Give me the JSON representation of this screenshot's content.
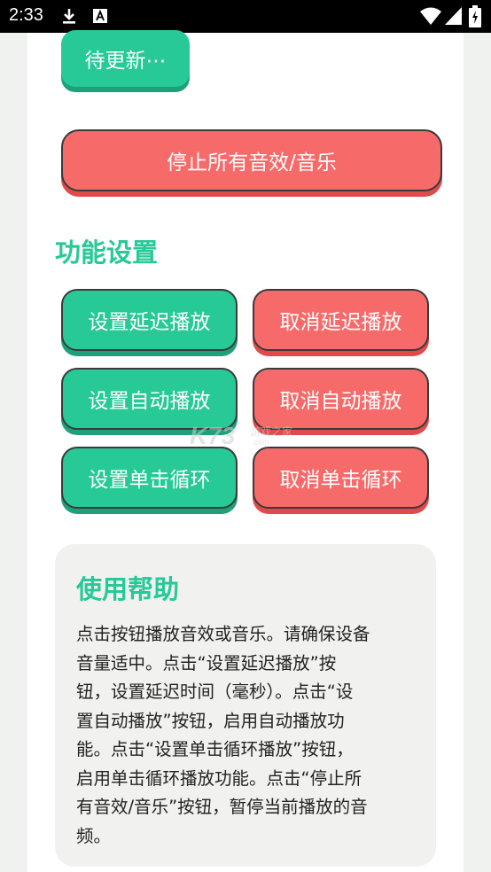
{
  "status_bar": {
    "time": "2:33",
    "icons": [
      "download-icon",
      "a-icon",
      "wifi-icon",
      "signal-icon",
      "battery-icon"
    ]
  },
  "buttons": {
    "pending_update": "待更新⋯",
    "stop_all": "停止所有音效/音乐"
  },
  "settings": {
    "title": "功能设置",
    "set_delay": "设置延迟播放",
    "cancel_delay": "取消延迟播放",
    "set_auto": "设置自动播放",
    "cancel_auto": "取消自动播放",
    "set_loop": "设置单击循环",
    "cancel_loop": "取消单击循环"
  },
  "help": {
    "title": "使用帮助",
    "lines": [
      "点击按钮播放音效或音乐。请确保设备",
      "音量适中。点击“设置延迟播放”按",
      "钮，设置延迟时间（毫秒）。点击“设",
      "置自动播放”按钮，启用自动播放功",
      "能。点击“设置单击循环播放”按钮，",
      "启用单击循环播放功能。点击“停止所",
      "有音效/音乐”按钮，暂停当前播放的音",
      "频。"
    ]
  },
  "watermark": {
    "main": "K73",
    "sub": "游戏之家",
    "url": ".com"
  },
  "colors": {
    "green": "#27c996",
    "red": "#f76a6a",
    "help_bg": "#f1f2f0"
  }
}
